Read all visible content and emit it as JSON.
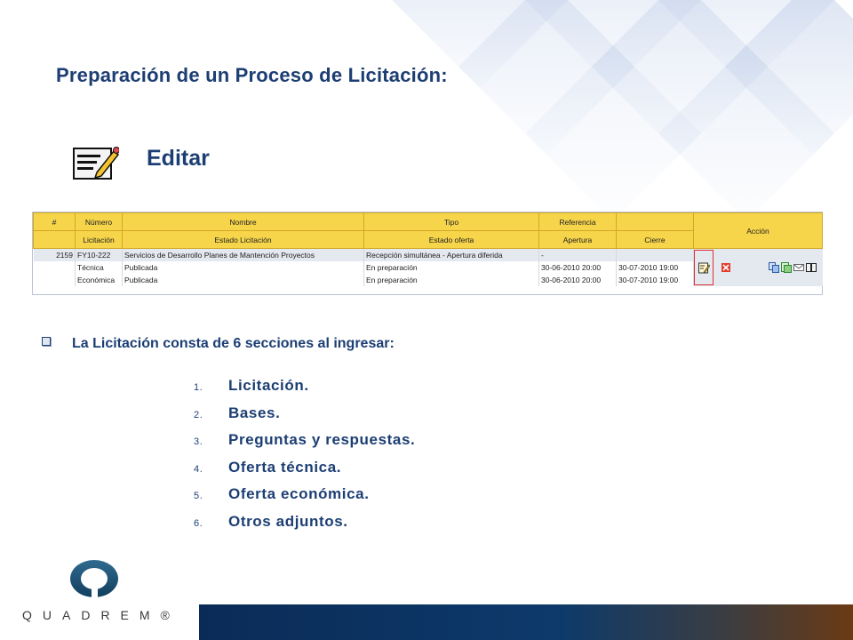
{
  "title": "Preparación de un Proceso de Licitación:",
  "edit_heading": "Editar",
  "table": {
    "header1": [
      "#",
      "Número",
      "Nombre",
      "Tipo",
      "Referencia",
      "",
      "Acción"
    ],
    "header2": [
      "",
      "Licitación",
      "Estado Licitación",
      "Estado oferta",
      "Apertura",
      "Cierre"
    ],
    "rows": [
      [
        "2159",
        "FY10-222",
        "Servicios de Desarrollo Planes de Mantención Proyectos",
        "Recepción simultánea - Apertura diferida",
        "-",
        ""
      ],
      [
        "",
        "Técnica",
        "Publicada",
        "En preparación",
        "30-06-2010 20:00",
        "30-07-2010 19:00"
      ],
      [
        "",
        "Económica",
        "Publicada",
        "En preparación",
        "30-06-2010 20:00",
        "30-07-2010 19:00"
      ]
    ]
  },
  "intro": "La Licitación consta de 6 secciones al ingresar:",
  "sections": [
    {
      "num": "1.",
      "label": "Licitación."
    },
    {
      "num": "2.",
      "label": "Bases."
    },
    {
      "num": "3.",
      "label": "Preguntas y respuestas."
    },
    {
      "num": "4.",
      "label": "Oferta técnica."
    },
    {
      "num": "5.",
      "label": "Oferta económica."
    },
    {
      "num": "6.",
      "label": "Otros adjuntos."
    }
  ],
  "logo_text": "QUADREM®",
  "colors": {
    "heading": "#1c3e73",
    "table_header": "#f7d54a",
    "table_border": "#d2a824"
  }
}
